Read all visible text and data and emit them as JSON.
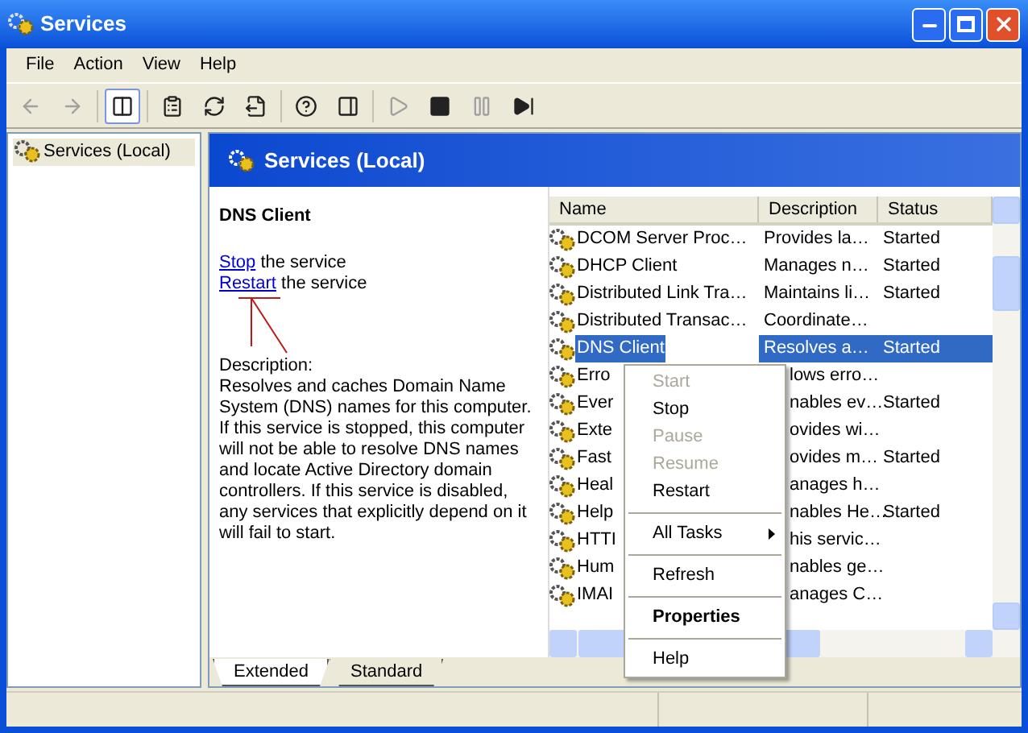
{
  "window": {
    "title": "Services"
  },
  "menu": [
    "File",
    "Action",
    "View",
    "Help"
  ],
  "toolbar": [
    {
      "kind": "back",
      "disabled": true
    },
    {
      "kind": "forward",
      "disabled": true
    },
    {
      "kind": "sep"
    },
    {
      "kind": "tree",
      "disabled": false
    },
    {
      "kind": "sep"
    },
    {
      "kind": "properties",
      "disabled": false
    },
    {
      "kind": "refresh",
      "disabled": false
    },
    {
      "kind": "export",
      "disabled": false
    },
    {
      "kind": "sep"
    },
    {
      "kind": "help",
      "disabled": false
    },
    {
      "kind": "pane",
      "disabled": false
    },
    {
      "kind": "sep"
    },
    {
      "kind": "play",
      "disabled": true
    },
    {
      "kind": "stop",
      "disabled": false
    },
    {
      "kind": "pause",
      "disabled": true
    },
    {
      "kind": "restart",
      "disabled": false
    }
  ],
  "tree": [
    {
      "label": "Services (Local)",
      "selected": false
    }
  ],
  "header": "Services (Local)",
  "details": {
    "title": "DNS Client",
    "actions": [
      {
        "link": "Stop",
        "text": "the service"
      },
      {
        "link": "Restart",
        "text": "the service"
      }
    ],
    "description_label": "Description:",
    "description": "Resolves and caches Domain Name System (DNS) names for this computer. If this service is stopped, this computer will not be able to resolve DNS names and locate Active Directory domain controllers. If this service is disabled, any services that explicitly depend on it will fail to start."
  },
  "table": {
    "columns": [
      "Name",
      "Description",
      "Status"
    ],
    "rows": [
      {
        "name": "DCOM Server Proc…",
        "description": "Provides la…",
        "status": "Started",
        "selected": false
      },
      {
        "name": "DHCP Client",
        "description": "Manages n…",
        "status": "Started",
        "selected": false
      },
      {
        "name": "Distributed Link Tra…",
        "description": "Maintains li…",
        "status": "Started",
        "selected": false
      },
      {
        "name": "Distributed Transac…",
        "description": "Coordinate…",
        "selected": false
      },
      {
        "name": "DNS Client",
        "description": "Resolves a…",
        "status": "Started",
        "selected": true
      },
      {
        "name": "Erro",
        "description": "lows erro…",
        "selected": false
      },
      {
        "name": "Ever",
        "description": "nables ev…",
        "status": "Started",
        "selected": false
      },
      {
        "name": "Exte",
        "description": "ovides wi…",
        "selected": false
      },
      {
        "name": "Fast",
        "description": "ovides m…",
        "status": "Started",
        "selected": false
      },
      {
        "name": "Heal",
        "description": "anages h…",
        "selected": false
      },
      {
        "name": "Help",
        "description": "nables He…",
        "status": "Started",
        "selected": false
      },
      {
        "name": "HTTI",
        "description": "his servic…",
        "selected": false
      },
      {
        "name": "Hum",
        "description": "nables ge…",
        "selected": false
      },
      {
        "name": "IMAI",
        "description": "anages C…",
        "selected": false
      }
    ]
  },
  "context_menu": [
    {
      "kind": "item",
      "label": "Start",
      "disabled": true
    },
    {
      "kind": "item",
      "label": "Stop",
      "disabled": false
    },
    {
      "kind": "item",
      "label": "Pause",
      "disabled": true
    },
    {
      "kind": "item",
      "label": "Resume",
      "disabled": true
    },
    {
      "kind": "item",
      "label": "Restart",
      "disabled": false
    },
    {
      "kind": "separator"
    },
    {
      "kind": "submenu",
      "label": "All Tasks",
      "disabled": false
    },
    {
      "kind": "separator"
    },
    {
      "kind": "item",
      "label": "Refresh",
      "disabled": false
    },
    {
      "kind": "separator"
    },
    {
      "kind": "default",
      "label": "Properties",
      "disabled": false
    },
    {
      "kind": "separator"
    },
    {
      "kind": "item",
      "label": "Help",
      "disabled": false
    }
  ],
  "tabs": [
    {
      "label": "Extended",
      "selected": true
    },
    {
      "label": "Standard",
      "selected": false
    }
  ]
}
